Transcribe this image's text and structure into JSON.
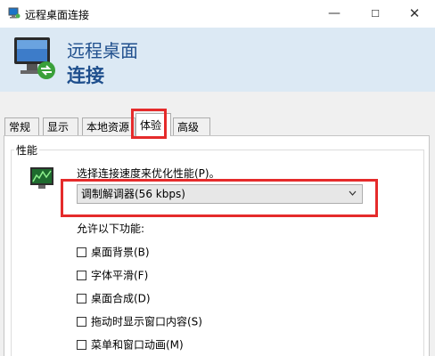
{
  "window": {
    "title": "远程桌面连接",
    "min_icon": "—",
    "max_icon": "☐",
    "close_icon": "✕"
  },
  "header": {
    "line1": "远程桌面",
    "line2": "连接"
  },
  "tabs": [
    {
      "label": "常规",
      "active": false
    },
    {
      "label": "显示",
      "active": false
    },
    {
      "label": "本地资源",
      "active": false
    },
    {
      "label": "体验",
      "active": true
    },
    {
      "label": "高级",
      "active": false
    }
  ],
  "performance": {
    "group_label": "性能",
    "speed_label": "选择连接速度来优化性能(P)。",
    "speed_value": "调制解调器(56 kbps)",
    "allow_label": "允许以下功能:",
    "options": [
      {
        "label": "桌面背景(B)",
        "checked": false
      },
      {
        "label": "字体平滑(F)",
        "checked": false
      },
      {
        "label": "桌面合成(D)",
        "checked": false
      },
      {
        "label": "拖动时显示窗口内容(S)",
        "checked": false
      },
      {
        "label": "菜单和窗口动画(M)",
        "checked": false
      }
    ]
  },
  "colors": {
    "highlight": "#e52b2b",
    "header_bg": "#dce9f4",
    "header_text": "#1f4f8d"
  }
}
